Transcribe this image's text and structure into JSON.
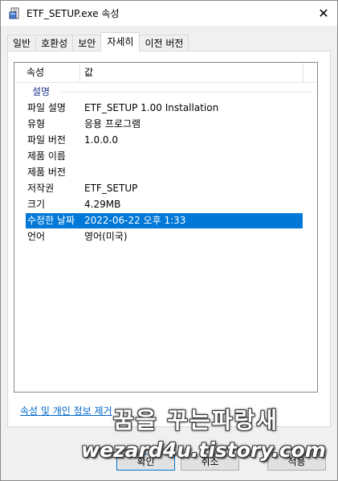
{
  "window": {
    "title": "ETF_SETUP.exe 속성",
    "close_glyph": "✕"
  },
  "tabs": [
    {
      "label": "일반",
      "active": false
    },
    {
      "label": "호환성",
      "active": false
    },
    {
      "label": "보안",
      "active": false
    },
    {
      "label": "자세히",
      "active": true
    },
    {
      "label": "이전 버전",
      "active": false
    }
  ],
  "details": {
    "columns": {
      "property": "속성",
      "value": "값"
    },
    "group_label": "설명",
    "rows": [
      {
        "key": "파일 설명",
        "value": "ETF_SETUP 1.00 Installation"
      },
      {
        "key": "유형",
        "value": "응용 프로그램"
      },
      {
        "key": "파일 버전",
        "value": "1.0.0.0"
      },
      {
        "key": "제품 이름",
        "value": ""
      },
      {
        "key": "제품 버전",
        "value": ""
      },
      {
        "key": "저작권",
        "value": "ETF_SETUP"
      },
      {
        "key": "크기",
        "value": "4.29MB"
      },
      {
        "key": "수정한 날짜",
        "value": "2022-06-22 오후 1:33",
        "selected": true
      },
      {
        "key": "언어",
        "value": "영어(미국)"
      }
    ]
  },
  "footer": {
    "remove_link": "속성 및 개인 정보 제거",
    "ok_label": "확인",
    "cancel_label": "취소",
    "apply_label": "적용"
  },
  "watermark": {
    "line1": "꿈을 꾸는파랑새",
    "line2": "wezard4u.tistory.com"
  },
  "colors": {
    "selection": "#0078d7",
    "link": "#0066cc",
    "group_label": "#1e3287"
  },
  "icons": {
    "app": "exe-file-icon",
    "close": "close-icon"
  }
}
